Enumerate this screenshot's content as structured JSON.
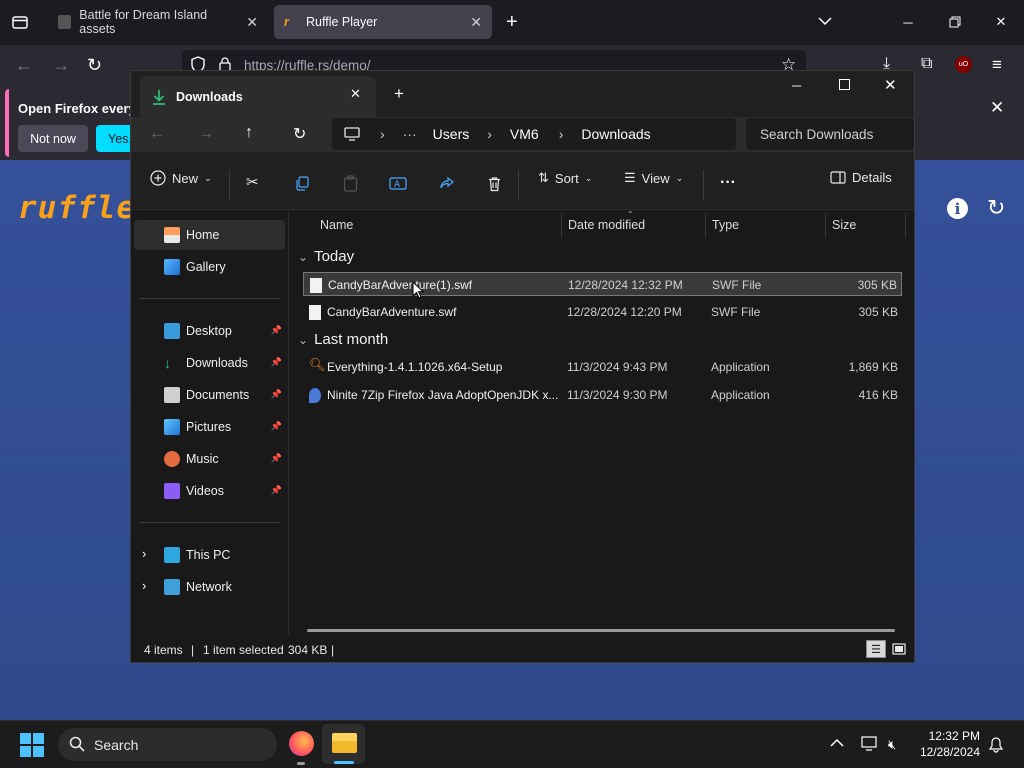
{
  "firefox": {
    "tabs": [
      {
        "title": "Battle for Dream Island assets",
        "active": false
      },
      {
        "title": "Ruffle Player",
        "active": true
      }
    ],
    "url": "https://ruffle.rs/demo/",
    "notification": {
      "text": "Open Firefox every",
      "not_now": "Not now",
      "yes": "Yes,"
    }
  },
  "ruffle_page": {
    "logo": "ruffle"
  },
  "explorer": {
    "tab_title": "Downloads",
    "breadcrumb": [
      "Users",
      "VM6",
      "Downloads"
    ],
    "search_placeholder": "Search Downloads",
    "commands": {
      "new": "New",
      "sort": "Sort",
      "view": "View",
      "details": "Details"
    },
    "sidebar": {
      "top": [
        {
          "label": "Home",
          "icon": "home-icon",
          "selected": true
        },
        {
          "label": "Gallery",
          "icon": "gallery-icon"
        }
      ],
      "pinned": [
        {
          "label": "Desktop",
          "icon": "desktop-icon"
        },
        {
          "label": "Downloads",
          "icon": "downloads-icon"
        },
        {
          "label": "Documents",
          "icon": "documents-icon"
        },
        {
          "label": "Pictures",
          "icon": "pictures-icon"
        },
        {
          "label": "Music",
          "icon": "music-icon"
        },
        {
          "label": "Videos",
          "icon": "videos-icon"
        }
      ],
      "bottom": [
        {
          "label": "This PC",
          "icon": "this-pc-icon"
        },
        {
          "label": "Network",
          "icon": "network-icon"
        }
      ]
    },
    "columns": [
      "Name",
      "Date modified",
      "Type",
      "Size"
    ],
    "groups": [
      {
        "label": "Today",
        "files": [
          {
            "name": "CandyBarAdventure(1).swf",
            "date": "12/28/2024 12:32 PM",
            "type": "SWF File",
            "size": "305 KB",
            "selected": true
          },
          {
            "name": "CandyBarAdventure.swf",
            "date": "12/28/2024 12:20 PM",
            "type": "SWF File",
            "size": "305 KB",
            "selected": false
          }
        ]
      },
      {
        "label": "Last month",
        "files": [
          {
            "name": "Everything-1.4.1.1026.x64-Setup",
            "date": "11/3/2024 9:43 PM",
            "type": "Application",
            "size": "1,869 KB",
            "selected": false
          },
          {
            "name": "Ninite 7Zip Firefox Java AdoptOpenJDK x...",
            "date": "11/3/2024 9:30 PM",
            "type": "Application",
            "size": "416 KB",
            "selected": false
          }
        ]
      }
    ],
    "status": {
      "count": "4 items",
      "selection": "1 item selected",
      "size": "304 KB"
    }
  },
  "taskbar": {
    "search": "Search",
    "time": "12:32 PM",
    "date": "12/28/2024"
  },
  "colors": {
    "accent": "#00ddff",
    "ruffle_orange": "#f9a11b",
    "page_blue": "#34509a",
    "explorer_bg": "#191919"
  }
}
